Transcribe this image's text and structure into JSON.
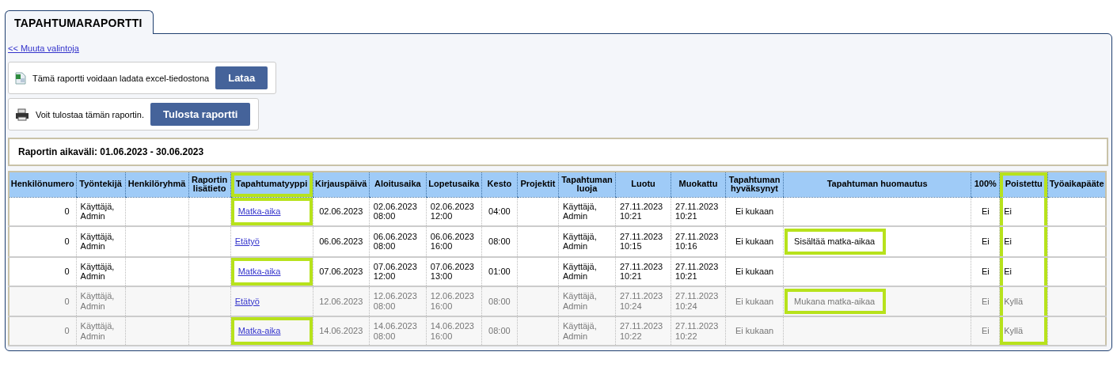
{
  "tab": {
    "label": "TAPAHTUMARAPORTTI",
    "selected": true
  },
  "back_link": "<< Muuta valintoja",
  "export_box": {
    "text": "Tämä raportti voidaan ladata excel-tiedostona",
    "button": "Lataa"
  },
  "print_box": {
    "text": "Voit tulostaa tämän raportin.",
    "button": "Tulosta raportti"
  },
  "range": "Raportin aikaväli: 01.06.2023 - 30.06.2023",
  "table": {
    "columns": [
      {
        "label": "Henkilönumero",
        "header_boxed": false,
        "column_boxed": false
      },
      {
        "label": "Työntekijä",
        "header_boxed": false,
        "column_boxed": false
      },
      {
        "label": "Henkilöryhmä",
        "header_boxed": false,
        "column_boxed": false
      },
      {
        "label": "Raportin lisätieto",
        "header_boxed": false,
        "column_boxed": false
      },
      {
        "label": "Tapahtumatyyppi",
        "header_boxed": true,
        "column_boxed": false
      },
      {
        "label": "Kirjauspäivä",
        "header_boxed": false,
        "column_boxed": false
      },
      {
        "label": "Aloitusaika",
        "header_boxed": false,
        "column_boxed": false
      },
      {
        "label": "Lopetusaika",
        "header_boxed": false,
        "column_boxed": false
      },
      {
        "label": "Kesto",
        "header_boxed": false,
        "column_boxed": false
      },
      {
        "label": "Projektit",
        "header_boxed": false,
        "column_boxed": false
      },
      {
        "label": "Tapahtuman luoja",
        "header_boxed": false,
        "column_boxed": false
      },
      {
        "label": "Luotu",
        "header_boxed": false,
        "column_boxed": false
      },
      {
        "label": "Muokattu",
        "header_boxed": false,
        "column_boxed": false
      },
      {
        "label": "Tapahtuman hyväksynyt",
        "header_boxed": false,
        "column_boxed": false
      },
      {
        "label": "Tapahtuman huomautus",
        "header_boxed": false,
        "column_boxed": false
      },
      {
        "label": "100%",
        "header_boxed": false,
        "column_boxed": false
      },
      {
        "label": "Poistettu",
        "header_boxed": false,
        "column_boxed": true
      },
      {
        "label": "Työaikapääte",
        "header_boxed": false,
        "column_boxed": false
      }
    ],
    "rows": [
      {
        "deleted": false,
        "type_highlighted": true,
        "number": "0",
        "employee": "Käyttäjä, Admin",
        "type": "Matka-aika",
        "date": "02.06.2023",
        "start": "02.06.2023 08:00",
        "end": "02.06.2023 12:00",
        "duration": "04:00",
        "creator": "Käyttäjä, Admin",
        "created": "27.11.2023 10:21",
        "modified": "27.11.2023 10:21",
        "approved": "Ei kukaan",
        "full": "Ei",
        "removed": "Ei"
      },
      {
        "deleted": false,
        "type_highlighted": false,
        "note_highlighted": true,
        "number": "0",
        "employee": "Käyttäjä, Admin",
        "type": "Etätyö",
        "date": "06.06.2023",
        "start": "06.06.2023 08:00",
        "end": "06.06.2023 16:00",
        "duration": "08:00",
        "creator": "Käyttäjä, Admin",
        "created": "27.11.2023 10:15",
        "modified": "27.11.2023 10:16",
        "approved": "Ei kukaan",
        "note": "Sisältää matka-aikaa",
        "full": "Ei",
        "removed": "Ei"
      },
      {
        "deleted": false,
        "type_highlighted": true,
        "number": "0",
        "employee": "Käyttäjä, Admin",
        "type": "Matka-aika",
        "date": "07.06.2023",
        "start": "07.06.2023 12:00",
        "end": "07.06.2023 13:00",
        "duration": "01:00",
        "creator": "Käyttäjä, Admin",
        "created": "27.11.2023 10:21",
        "modified": "27.11.2023 10:21",
        "approved": "Ei kukaan",
        "full": "Ei",
        "removed": "Ei"
      },
      {
        "deleted": true,
        "type_highlighted": false,
        "note_highlighted": true,
        "number": "0",
        "employee": "Käyttäjä, Admin",
        "type": "Etätyö",
        "date": "12.06.2023",
        "start": "12.06.2023 08:00",
        "end": "12.06.2023 16:00",
        "duration": "08:00",
        "creator": "Käyttäjä, Admin",
        "created": "27.11.2023 10:24",
        "modified": "27.11.2023 10:24",
        "approved": "Ei kukaan",
        "note": "Mukana matka-aikaa",
        "full": "Ei",
        "removed": "Kyllä"
      },
      {
        "deleted": true,
        "type_highlighted": true,
        "number": "0",
        "employee": "Käyttäjä, Admin",
        "type": "Matka-aika",
        "date": "14.06.2023",
        "start": "14.06.2023 08:00",
        "end": "14.06.2023 16:00",
        "duration": "08:00",
        "creator": "Käyttäjä, Admin",
        "created": "27.11.2023 10:22",
        "modified": "27.11.2023 10:22",
        "approved": "Ei kukaan",
        "full": "Ei",
        "removed": "Kyllä"
      }
    ]
  }
}
